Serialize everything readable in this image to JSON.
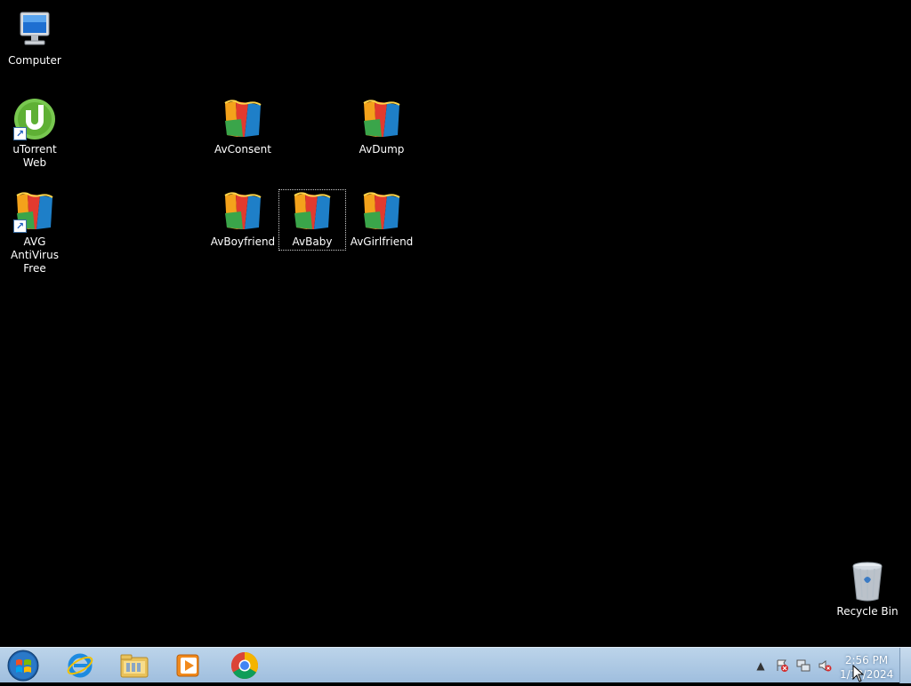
{
  "desktop": {
    "icons": [
      {
        "label": "Computer",
        "icon": "computer-icon"
      },
      {
        "label": "uTorrent Web",
        "icon": "utorrent-icon"
      },
      {
        "label": "AVG AntiVirus Free",
        "icon": "avg-icon"
      },
      {
        "label": "AvConsent",
        "icon": "avg-icon"
      },
      {
        "label": "AvBoyfriend",
        "icon": "avg-icon"
      },
      {
        "label": "AvBaby",
        "icon": "avg-icon",
        "selected": true
      },
      {
        "label": "AvDump",
        "icon": "avg-icon"
      },
      {
        "label": "AvGirlfriend",
        "icon": "avg-icon"
      },
      {
        "label": "Recycle Bin",
        "icon": "recycle-bin-icon"
      }
    ]
  },
  "taskbar": {
    "pinned": [
      "start-orb-icon",
      "internet-explorer-icon",
      "file-explorer-icon",
      "media-player-icon",
      "chrome-icon"
    ],
    "tray": [
      "show-hidden-icons-icon",
      "action-center-icon",
      "network-icon",
      "volume-muted-icon"
    ],
    "clock": {
      "time": "2:56 PM",
      "date": "1/1?/2024"
    }
  },
  "colors": {
    "desktop": "#000000",
    "taskbar": "#9fbede",
    "avg_red": "#e23a2e",
    "avg_green": "#3aa54a",
    "avg_blue": "#1e7fc8",
    "avg_orange": "#f4a21b"
  }
}
